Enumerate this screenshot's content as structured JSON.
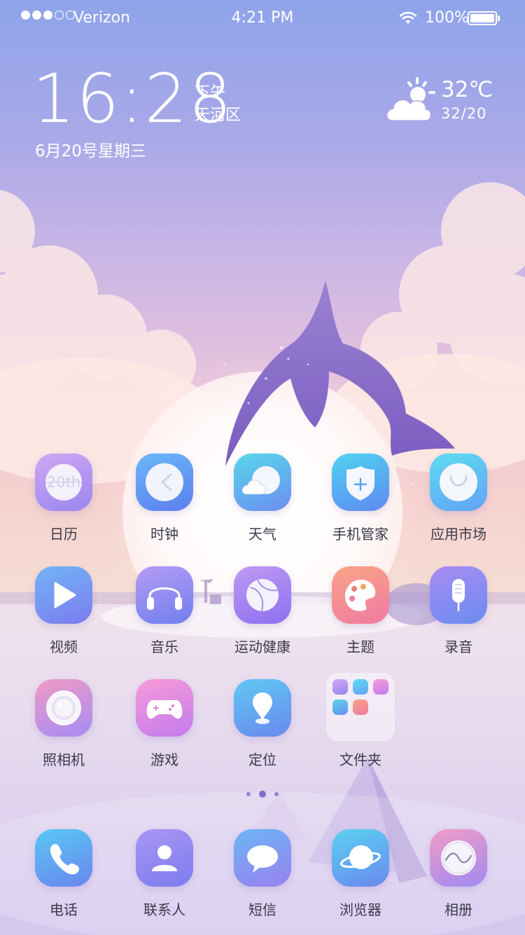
{
  "status_bar": {
    "carrier": "Verizon",
    "time": "4:21 PM",
    "battery": "100%",
    "battery_level": 1.0,
    "signal_bars": 3,
    "signal_total": 5
  },
  "widget": {
    "clock": "16:28",
    "ampm": "下午",
    "district": "天河区",
    "date": "6月20号星期三",
    "temperature": "32℃",
    "temp_range": "32/20",
    "weather_icon": "partly-sunny-icon"
  },
  "apps": [
    {
      "label": "日历",
      "icon": "calendar-icon",
      "calendar_text": "20th"
    },
    {
      "label": "时钟",
      "icon": "clock-icon"
    },
    {
      "label": "天气",
      "icon": "weather-cloud-icon"
    },
    {
      "label": "手机管家",
      "icon": "shield-plus-icon"
    },
    {
      "label": "应用市场",
      "icon": "app-market-icon"
    },
    {
      "label": "视频",
      "icon": "play-icon"
    },
    {
      "label": "音乐",
      "icon": "headphones-icon"
    },
    {
      "label": "运动健康",
      "icon": "ball-icon"
    },
    {
      "label": "主题",
      "icon": "palette-icon"
    },
    {
      "label": "录音",
      "icon": "microphone-icon"
    },
    {
      "label": "照相机",
      "icon": "camera-lens-icon"
    },
    {
      "label": "游戏",
      "icon": "gamepad-icon"
    },
    {
      "label": "定位",
      "icon": "location-pin-icon"
    },
    {
      "label": "文件夹",
      "icon": "folder-icon"
    }
  ],
  "dock": [
    {
      "label": "电话",
      "icon": "phone-icon"
    },
    {
      "label": "联系人",
      "icon": "contact-icon"
    },
    {
      "label": "短信",
      "icon": "message-icon"
    },
    {
      "label": "浏览器",
      "icon": "browser-icon"
    },
    {
      "label": "相册",
      "icon": "gallery-icon"
    }
  ],
  "page_indicator": {
    "count": 3,
    "current": 2
  },
  "colors": {
    "label_text": "#3a3a4a",
    "dolphin": "#8a6cc8",
    "indicator": "#7f6fc6"
  }
}
